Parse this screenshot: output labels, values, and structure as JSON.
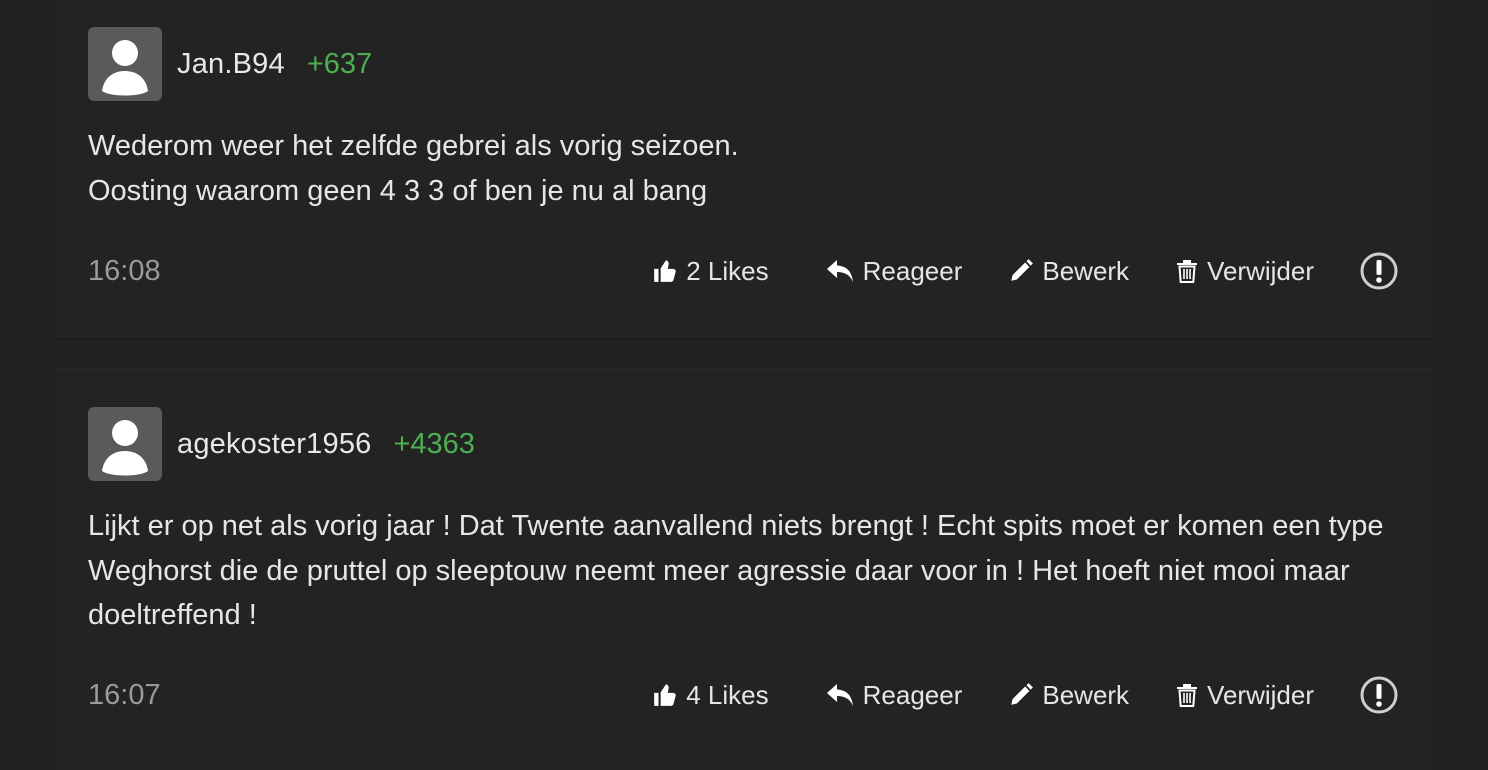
{
  "comments": [
    {
      "username": "Jan.B94",
      "score": "+637",
      "lines": [
        "Wederom weer het zelfde gebrei als vorig seizoen.",
        "Oosting waarom geen 4 3 3 of ben je nu al bang"
      ],
      "time": "16:08",
      "likes_label": "2 Likes"
    },
    {
      "username": "agekoster1956",
      "score": "+4363",
      "lines": [
        "Lijkt er op net als vorig jaar ! Dat Twente aanvallend niets brengt ! Echt spits moet er komen een type Weghorst die de pruttel op sleeptouw neemt meer agressie daar voor in ! Het hoeft niet mooi maar doeltreffend !"
      ],
      "time": "16:07",
      "likes_label": "4 Likes"
    }
  ],
  "actions": {
    "reply_label": "Reageer",
    "edit_label": "Bewerk",
    "delete_label": "Verwijder"
  },
  "icons": {
    "like": "thumbs-up-icon",
    "reply": "reply-arrow-icon",
    "edit": "pencil-icon",
    "delete": "trash-icon",
    "report": "exclamation-circle-icon",
    "avatar": "user-silhouette-icon"
  },
  "colors": {
    "background": "#222222",
    "score": "#4caf50",
    "text": "#e6e6e6",
    "muted": "#9a9a9a",
    "avatar_bg": "#5a5a5a"
  }
}
